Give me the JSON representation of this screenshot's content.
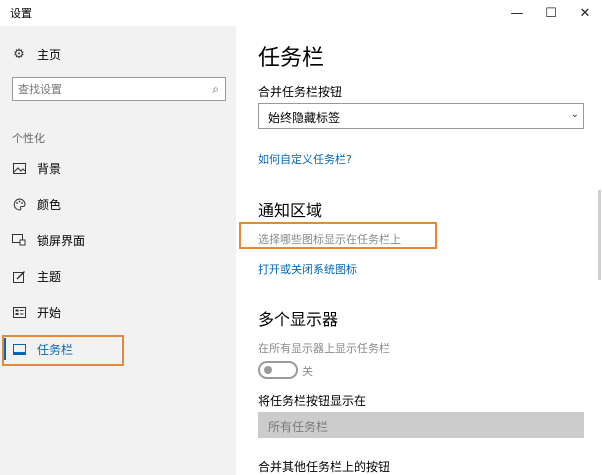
{
  "window": {
    "title": "设置",
    "controls": {
      "minimize": "—",
      "maximize": "☐",
      "close": "✕"
    }
  },
  "sidebar": {
    "home": {
      "label": "主页",
      "icon": "gear-icon"
    },
    "search": {
      "placeholder": "查找设置",
      "icon": "search-icon"
    },
    "section_label": "个性化",
    "items": [
      {
        "label": "背景",
        "icon": "picture-icon"
      },
      {
        "label": "颜色",
        "icon": "palette-icon"
      },
      {
        "label": "锁屏界面",
        "icon": "lock-screen-icon"
      },
      {
        "label": "主题",
        "icon": "theme-icon"
      },
      {
        "label": "开始",
        "icon": "start-menu-icon"
      },
      {
        "label": "任务栏",
        "icon": "taskbar-icon",
        "selected": true
      }
    ]
  },
  "main": {
    "title": "任务栏",
    "combine_buttons": {
      "label": "合并任务栏按钮",
      "value": "始终隐藏标签"
    },
    "customize_link": "如何自定义任务栏?",
    "notification_area": {
      "title": "通知区域",
      "select_icons_link": "选择哪些图标显示在任务栏上",
      "system_icons_link": "打开或关闭系统图标"
    },
    "multiple_displays": {
      "title": "多个显示器",
      "show_on_all_label": "在所有显示器上显示任务栏",
      "toggle_state": "关",
      "show_buttons_on_label": "将任务栏按钮显示在",
      "show_buttons_on_value": "所有任务栏",
      "combine_other_label": "合并其他任务栏上的按钮"
    }
  },
  "colors": {
    "accent": "#0067b8",
    "highlight": "#e2893a",
    "sidebar_bg": "#f2f2f2"
  }
}
